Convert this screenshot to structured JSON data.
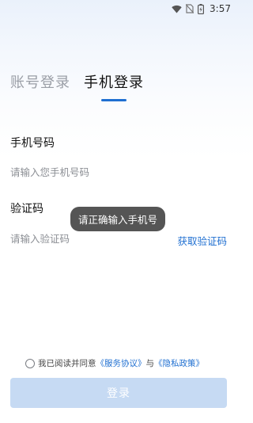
{
  "status_bar": {
    "time": "3:57",
    "icons": [
      "wifi-icon",
      "no-sim-icon",
      "battery-charging-icon"
    ]
  },
  "tabs": [
    {
      "label": "账号登录",
      "active": false
    },
    {
      "label": "手机登录",
      "active": true
    }
  ],
  "form": {
    "phone_label": "手机号码",
    "phone_placeholder": "请输入您手机号码",
    "phone_value": "",
    "code_label": "验证码",
    "code_placeholder": "请输入验证码",
    "code_value": "",
    "get_code_label": "获取验证码"
  },
  "toast": {
    "message": "请正确输入手机号"
  },
  "agreement": {
    "checked": false,
    "prefix": "我已阅读并同意",
    "service_link": "《服务协议》",
    "and_text": "与",
    "privacy_link": "《隐私政策》"
  },
  "login_button": {
    "label": "登录"
  },
  "colors": {
    "accent": "#1f6fd1",
    "button_disabled": "#c6daf3",
    "toast_bg": "#555555"
  }
}
